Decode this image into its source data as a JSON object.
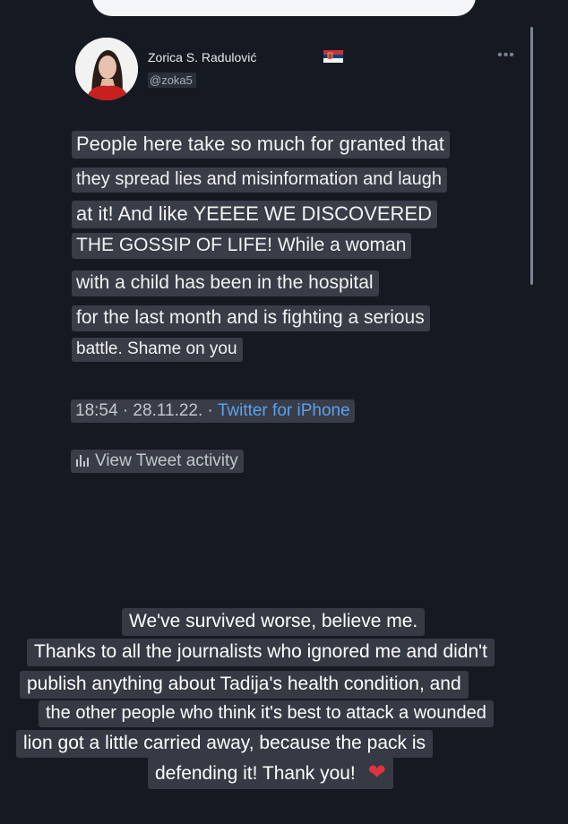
{
  "tweet": {
    "display_name": "Zorica S. Radulović",
    "handle": "@zoka5",
    "lines": [
      "People here take so much for granted that",
      "they spread lies and misinformation and laugh",
      "at it! And like YEEEE WE DISCOVERED",
      "THE GOSSIP OF LIFE! While a woman",
      "with a child has been in the hospital",
      "for the last month and is fighting a serious",
      "battle. Shame on you"
    ],
    "time": "18:54 · 28.11.22. · ",
    "source": "Twitter for iPhone",
    "activity_label": "View Tweet activity"
  },
  "caption": {
    "lines": [
      "We've survived worse, believe me.",
      "Thanks to all the journalists who ignored me and didn't",
      "publish anything about Tadija's health condition, and",
      "the other people who think it's best to attack a wounded",
      "lion got a little carried away, because the pack is",
      "defending it! Thank you!"
    ],
    "emoji": "❤"
  },
  "icons": {
    "more": "more-horizontal-icon",
    "flag": "serbia-flag-icon",
    "activity": "bar-chart-icon"
  },
  "colors": {
    "background": "#151a22",
    "highlight": "#383d47",
    "link": "#5aa0ee",
    "heart": "#e0343c"
  }
}
